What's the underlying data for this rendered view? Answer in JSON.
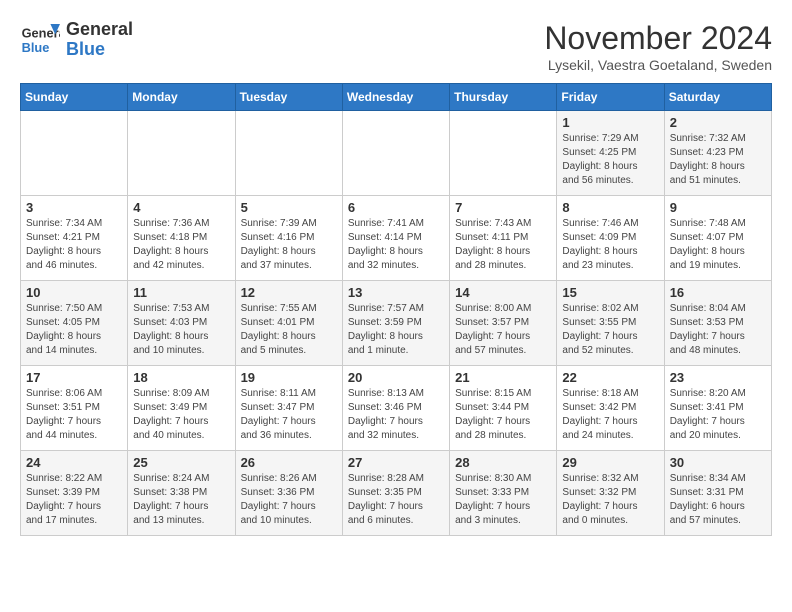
{
  "header": {
    "logo_line1": "General",
    "logo_line2": "Blue",
    "month": "November 2024",
    "location": "Lysekil, Vaestra Goetaland, Sweden"
  },
  "days_of_week": [
    "Sunday",
    "Monday",
    "Tuesday",
    "Wednesday",
    "Thursday",
    "Friday",
    "Saturday"
  ],
  "weeks": [
    [
      {
        "day": "",
        "info": ""
      },
      {
        "day": "",
        "info": ""
      },
      {
        "day": "",
        "info": ""
      },
      {
        "day": "",
        "info": ""
      },
      {
        "day": "",
        "info": ""
      },
      {
        "day": "1",
        "info": "Sunrise: 7:29 AM\nSunset: 4:25 PM\nDaylight: 8 hours\nand 56 minutes."
      },
      {
        "day": "2",
        "info": "Sunrise: 7:32 AM\nSunset: 4:23 PM\nDaylight: 8 hours\nand 51 minutes."
      }
    ],
    [
      {
        "day": "3",
        "info": "Sunrise: 7:34 AM\nSunset: 4:21 PM\nDaylight: 8 hours\nand 46 minutes."
      },
      {
        "day": "4",
        "info": "Sunrise: 7:36 AM\nSunset: 4:18 PM\nDaylight: 8 hours\nand 42 minutes."
      },
      {
        "day": "5",
        "info": "Sunrise: 7:39 AM\nSunset: 4:16 PM\nDaylight: 8 hours\nand 37 minutes."
      },
      {
        "day": "6",
        "info": "Sunrise: 7:41 AM\nSunset: 4:14 PM\nDaylight: 8 hours\nand 32 minutes."
      },
      {
        "day": "7",
        "info": "Sunrise: 7:43 AM\nSunset: 4:11 PM\nDaylight: 8 hours\nand 28 minutes."
      },
      {
        "day": "8",
        "info": "Sunrise: 7:46 AM\nSunset: 4:09 PM\nDaylight: 8 hours\nand 23 minutes."
      },
      {
        "day": "9",
        "info": "Sunrise: 7:48 AM\nSunset: 4:07 PM\nDaylight: 8 hours\nand 19 minutes."
      }
    ],
    [
      {
        "day": "10",
        "info": "Sunrise: 7:50 AM\nSunset: 4:05 PM\nDaylight: 8 hours\nand 14 minutes."
      },
      {
        "day": "11",
        "info": "Sunrise: 7:53 AM\nSunset: 4:03 PM\nDaylight: 8 hours\nand 10 minutes."
      },
      {
        "day": "12",
        "info": "Sunrise: 7:55 AM\nSunset: 4:01 PM\nDaylight: 8 hours\nand 5 minutes."
      },
      {
        "day": "13",
        "info": "Sunrise: 7:57 AM\nSunset: 3:59 PM\nDaylight: 8 hours\nand 1 minute."
      },
      {
        "day": "14",
        "info": "Sunrise: 8:00 AM\nSunset: 3:57 PM\nDaylight: 7 hours\nand 57 minutes."
      },
      {
        "day": "15",
        "info": "Sunrise: 8:02 AM\nSunset: 3:55 PM\nDaylight: 7 hours\nand 52 minutes."
      },
      {
        "day": "16",
        "info": "Sunrise: 8:04 AM\nSunset: 3:53 PM\nDaylight: 7 hours\nand 48 minutes."
      }
    ],
    [
      {
        "day": "17",
        "info": "Sunrise: 8:06 AM\nSunset: 3:51 PM\nDaylight: 7 hours\nand 44 minutes."
      },
      {
        "day": "18",
        "info": "Sunrise: 8:09 AM\nSunset: 3:49 PM\nDaylight: 7 hours\nand 40 minutes."
      },
      {
        "day": "19",
        "info": "Sunrise: 8:11 AM\nSunset: 3:47 PM\nDaylight: 7 hours\nand 36 minutes."
      },
      {
        "day": "20",
        "info": "Sunrise: 8:13 AM\nSunset: 3:46 PM\nDaylight: 7 hours\nand 32 minutes."
      },
      {
        "day": "21",
        "info": "Sunrise: 8:15 AM\nSunset: 3:44 PM\nDaylight: 7 hours\nand 28 minutes."
      },
      {
        "day": "22",
        "info": "Sunrise: 8:18 AM\nSunset: 3:42 PM\nDaylight: 7 hours\nand 24 minutes."
      },
      {
        "day": "23",
        "info": "Sunrise: 8:20 AM\nSunset: 3:41 PM\nDaylight: 7 hours\nand 20 minutes."
      }
    ],
    [
      {
        "day": "24",
        "info": "Sunrise: 8:22 AM\nSunset: 3:39 PM\nDaylight: 7 hours\nand 17 minutes."
      },
      {
        "day": "25",
        "info": "Sunrise: 8:24 AM\nSunset: 3:38 PM\nDaylight: 7 hours\nand 13 minutes."
      },
      {
        "day": "26",
        "info": "Sunrise: 8:26 AM\nSunset: 3:36 PM\nDaylight: 7 hours\nand 10 minutes."
      },
      {
        "day": "27",
        "info": "Sunrise: 8:28 AM\nSunset: 3:35 PM\nDaylight: 7 hours\nand 6 minutes."
      },
      {
        "day": "28",
        "info": "Sunrise: 8:30 AM\nSunset: 3:33 PM\nDaylight: 7 hours\nand 3 minutes."
      },
      {
        "day": "29",
        "info": "Sunrise: 8:32 AM\nSunset: 3:32 PM\nDaylight: 7 hours\nand 0 minutes."
      },
      {
        "day": "30",
        "info": "Sunrise: 8:34 AM\nSunset: 3:31 PM\nDaylight: 6 hours\nand 57 minutes."
      }
    ]
  ]
}
